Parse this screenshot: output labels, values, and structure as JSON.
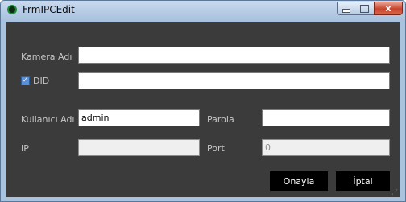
{
  "window": {
    "title": "FrmIPCEdit",
    "close_glyph": "x",
    "icons": {
      "app": "app-icon",
      "minimize": "minimize-icon",
      "maximize": "maximize-icon",
      "close": "close-icon"
    }
  },
  "form": {
    "camera_name": {
      "label": "Kamera Adı",
      "value": ""
    },
    "did": {
      "label": "DID",
      "checked": true,
      "check_glyph": "✓",
      "value": ""
    },
    "username": {
      "label": "Kullanıcı Adı",
      "value": "admin"
    },
    "password": {
      "label": "Parola",
      "value": ""
    },
    "ip": {
      "label": "IP",
      "value": ""
    },
    "port": {
      "label": "Port",
      "value": "0"
    }
  },
  "buttons": {
    "confirm": "Onayla",
    "cancel": "İptal"
  },
  "colors": {
    "background": "#3b3b3b",
    "label": "#c6c6c6",
    "button": "#000000",
    "titlebar": "#b3cae4"
  }
}
